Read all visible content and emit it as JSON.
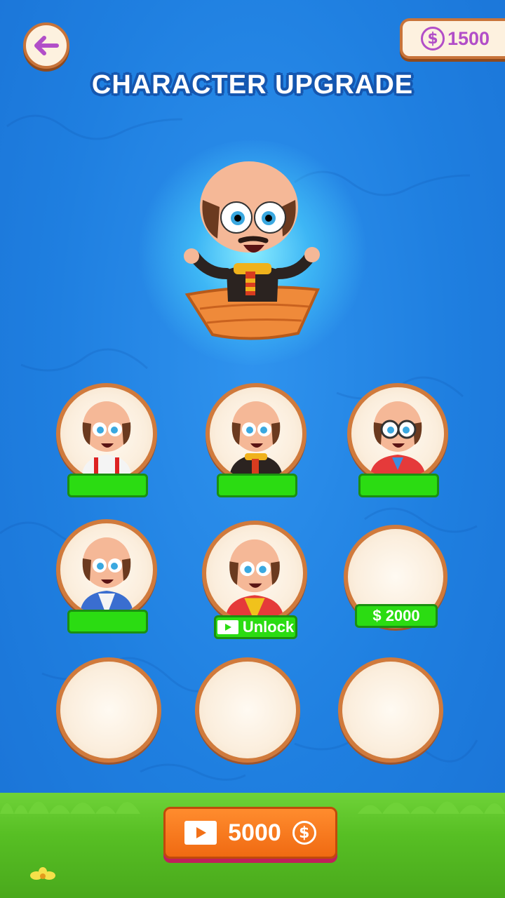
{
  "header": {
    "title": "CHARACTER UPGRADE",
    "coins": "1500",
    "coin_symbol": "$"
  },
  "hero": {
    "outfit": "scarf-coat",
    "vehicle": "boat"
  },
  "slots": [
    {
      "outfit": "white-shirt-red-suspenders",
      "tag_label": ""
    },
    {
      "outfit": "black-coat-scarf",
      "tag_label": ""
    },
    {
      "outfit": "red-sweater-glasses",
      "tag_label": ""
    },
    {
      "outfit": "blue-vest",
      "tag_label": ""
    },
    {
      "outfit": "red-vest-yellow-shirt",
      "tag_label": "Unlock"
    },
    {
      "outfit": "empty",
      "tag_label": "$ 2000"
    },
    {
      "outfit": "empty"
    },
    {
      "outfit": "empty"
    },
    {
      "outfit": "empty"
    }
  ],
  "footer": {
    "video_reward": "5000",
    "coin_symbol": "$"
  },
  "colors": {
    "accent_green": "#2bdc12",
    "slot_border": "#d07a3c",
    "coin_purple": "#b24ec8",
    "button_orange": "#f06a12"
  }
}
